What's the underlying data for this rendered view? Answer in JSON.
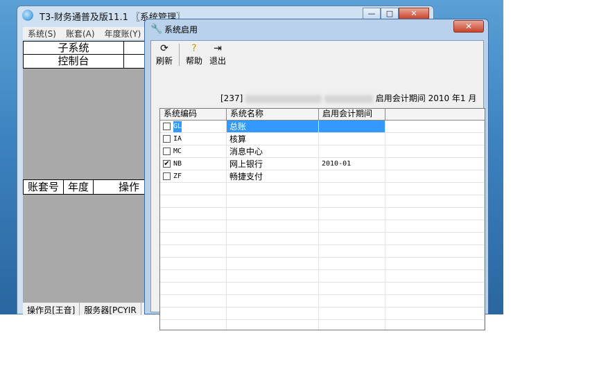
{
  "main": {
    "title": "T3-财务通普及版11.1 〖系统管理〗",
    "buttons": {
      "minimize": "—",
      "maximize": "□",
      "close": "✕"
    },
    "menu": [
      "系统(S)",
      "账套(A)",
      "年度账(Y)"
    ],
    "subsystem_rows": [
      "子系统",
      "控制台"
    ],
    "account_headers": [
      "账套号",
      "年度",
      "操作"
    ],
    "status": [
      "操作员[王音]",
      "服务器[PCYIR"
    ]
  },
  "dialog": {
    "title": "系统启用",
    "close": "✕",
    "toolbar": [
      {
        "label": "刷新",
        "icon": "refresh-icon"
      },
      {
        "label": "帮助",
        "icon": "help-icon"
      },
      {
        "label": "退出",
        "icon": "exit-icon"
      }
    ],
    "info_prefix": "[237]",
    "info_suffix": "启用会计期间 2010 年1 月",
    "columns": [
      "系统编码",
      "系统名称",
      "启用会计期间"
    ],
    "rows": [
      {
        "code": "GL",
        "name": "总账",
        "period": "",
        "checked": false
      },
      {
        "code": "IA",
        "name": "核算",
        "period": "",
        "checked": false
      },
      {
        "code": "MC",
        "name": "消息中心",
        "period": "",
        "checked": false
      },
      {
        "code": "NB",
        "name": "网上银行",
        "period": "2010-01",
        "checked": true
      },
      {
        "code": "ZF",
        "name": "畅捷支付",
        "period": "",
        "checked": false
      }
    ]
  }
}
